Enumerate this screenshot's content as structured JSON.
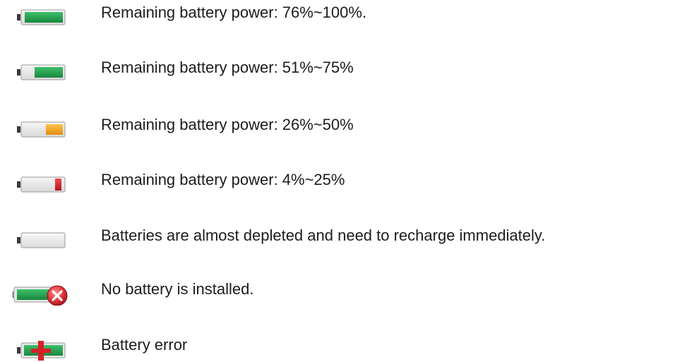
{
  "legend": {
    "items": [
      {
        "icon": "battery-full-icon",
        "text": "Remaining battery power: 76%~100%.",
        "level_fraction": 1.0,
        "fill_color": "#1f9e4a"
      },
      {
        "icon": "battery-three-quarters-icon",
        "text": "Remaining battery power: 51%~75%",
        "level_fraction": 0.75,
        "fill_color": "#1f9e4a"
      },
      {
        "icon": "battery-half-icon",
        "text": "Remaining battery power: 26%~50%",
        "level_fraction": 0.5,
        "fill_color": "#f2a420"
      },
      {
        "icon": "battery-low-icon",
        "text": "Remaining battery power: 4%~25%",
        "level_fraction": 0.25,
        "fill_color": "#d8202a"
      },
      {
        "icon": "battery-empty-icon",
        "text": "Batteries are almost depleted and need to recharge immediately.",
        "level_fraction": 0.0,
        "fill_color": "#cccccc"
      },
      {
        "icon": "battery-not-installed-icon",
        "text": "No battery is installed.",
        "status_color": "#d9343b"
      },
      {
        "icon": "battery-error-icon",
        "text": "Battery error",
        "status_color": "#d8202a"
      }
    ]
  }
}
